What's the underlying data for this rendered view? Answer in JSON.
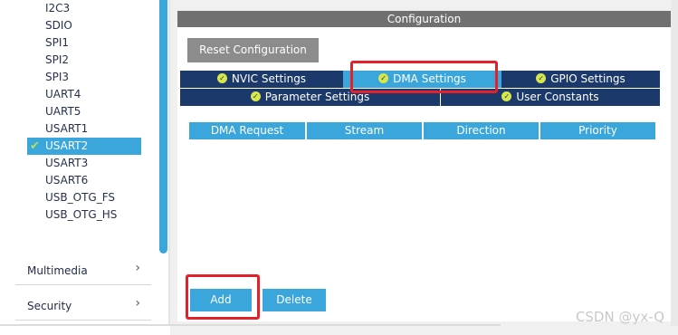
{
  "sidebar": {
    "peripherals": [
      {
        "label": "I2C3",
        "selected": false
      },
      {
        "label": "SDIO",
        "selected": false
      },
      {
        "label": "SPI1",
        "selected": false
      },
      {
        "label": "SPI2",
        "selected": false
      },
      {
        "label": "SPI3",
        "selected": false
      },
      {
        "label": "UART4",
        "selected": false
      },
      {
        "label": "UART5",
        "selected": false
      },
      {
        "label": "USART1",
        "selected": false
      },
      {
        "label": "USART2",
        "selected": true
      },
      {
        "label": "USART3",
        "selected": false
      },
      {
        "label": "USART6",
        "selected": false
      },
      {
        "label": "USB_OTG_FS",
        "selected": false
      },
      {
        "label": "USB_OTG_HS",
        "selected": false
      }
    ],
    "selected_check": "✔",
    "categories": [
      {
        "label": "Multimedia"
      },
      {
        "label": "Security"
      }
    ],
    "chevron": "›"
  },
  "config": {
    "header": "Configuration",
    "reset_label": "Reset Configuration",
    "tabs_row1": [
      {
        "label": "NVIC Settings",
        "active": false
      },
      {
        "label": "DMA Settings",
        "active": true
      },
      {
        "label": "GPIO Settings",
        "active": false
      }
    ],
    "tabs_row2": [
      {
        "label": "Parameter Settings",
        "active": false
      },
      {
        "label": "User Constants",
        "active": false
      }
    ],
    "table_headers": [
      "DMA Request",
      "Stream",
      "Direction",
      "Priority"
    ],
    "add_label": "Add",
    "delete_label": "Delete"
  },
  "watermark": "CSDN @yx-Q",
  "colors": {
    "accent": "#3aa6db",
    "tab_dark": "#1b3a6b",
    "highlight": "#e3212b",
    "status_dot": "#d7e74a"
  }
}
